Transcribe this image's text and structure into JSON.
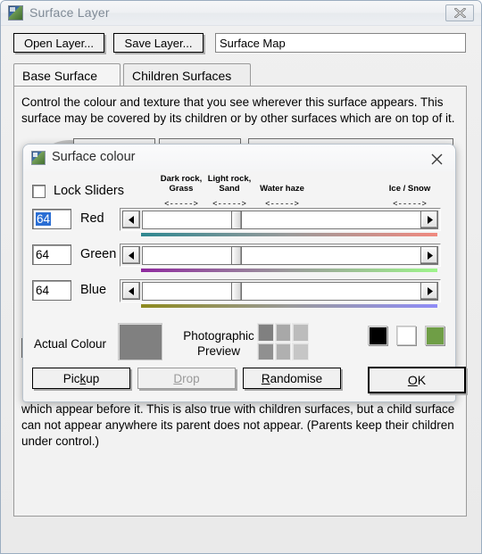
{
  "window": {
    "title": "Surface Layer",
    "icon": "surface-layer-icon",
    "close_label": "✕"
  },
  "toolbar": {
    "open_layer_label": "Open Layer...",
    "save_layer_label": "Save Layer...",
    "layer_name_value": "Surface Map"
  },
  "tabs": [
    {
      "label": "Base Surface",
      "active": true
    },
    {
      "label": "Children Surfaces",
      "active": false
    }
  ],
  "panel": {
    "description": "Control the colour and texture that you see wherever this surface appears. This surface may be covered by its children or by other surfaces which are on top of it.",
    "description_tail": "which appear before it. This is also true with children surfaces, but a child surface can not appear anywhere its parent does not appear. (Parents keep their children under control.)"
  },
  "dialog": {
    "title": "Surface colour",
    "icon": "surface-colour-icon",
    "close_label": "✕",
    "lock_sliders_label": "Lock Sliders",
    "lock_sliders_checked": false,
    "zones": [
      {
        "label": "Dark rock,\nGrass",
        "marker": "<----->"
      },
      {
        "label": "Light rock,\nSand",
        "marker": "<----->"
      },
      {
        "label": "Water haze",
        "marker": "<----->"
      },
      {
        "label": "Ice / Snow",
        "marker": "<----->"
      }
    ],
    "channels": [
      {
        "name": "Red",
        "value": "64",
        "selected": true,
        "gradient_from": "#2e8790",
        "gradient_mid": "#9a9a9a",
        "gradient_to": "#f0897f"
      },
      {
        "name": "Green",
        "value": "64",
        "selected": false,
        "gradient_from": "#8f2a9e",
        "gradient_mid": "#9a9a9a",
        "gradient_to": "#9df58a"
      },
      {
        "name": "Blue",
        "value": "64",
        "selected": false,
        "gradient_from": "#8d8a1e",
        "gradient_mid": "#9a9a9a",
        "gradient_to": "#8f8cf7"
      }
    ],
    "actual_colour_label": "Actual Colour",
    "actual_colour_hex": "#808080",
    "photographic_preview_label": "Photographic\nPreview",
    "photographic_preview_cells": [
      "#808080",
      "#a8a8a8",
      "#bcbcbc",
      "#909090",
      "#b0b0b0",
      "#c6c6c6"
    ],
    "preset_swatches": [
      {
        "name": "black-swatch",
        "hex": "#000000"
      },
      {
        "name": "white-swatch",
        "hex": "#ffffff"
      },
      {
        "name": "green-swatch",
        "hex": "#6f9e46"
      }
    ],
    "buttons": {
      "pickup": {
        "label": "Pickup",
        "accel": "k",
        "enabled": true
      },
      "drop": {
        "label": "Drop",
        "accel": "D",
        "enabled": false
      },
      "randomise": {
        "label": "Randomise",
        "accel": "R",
        "enabled": true
      },
      "ok": {
        "label": "OK",
        "accel": "O",
        "enabled": true
      }
    }
  }
}
